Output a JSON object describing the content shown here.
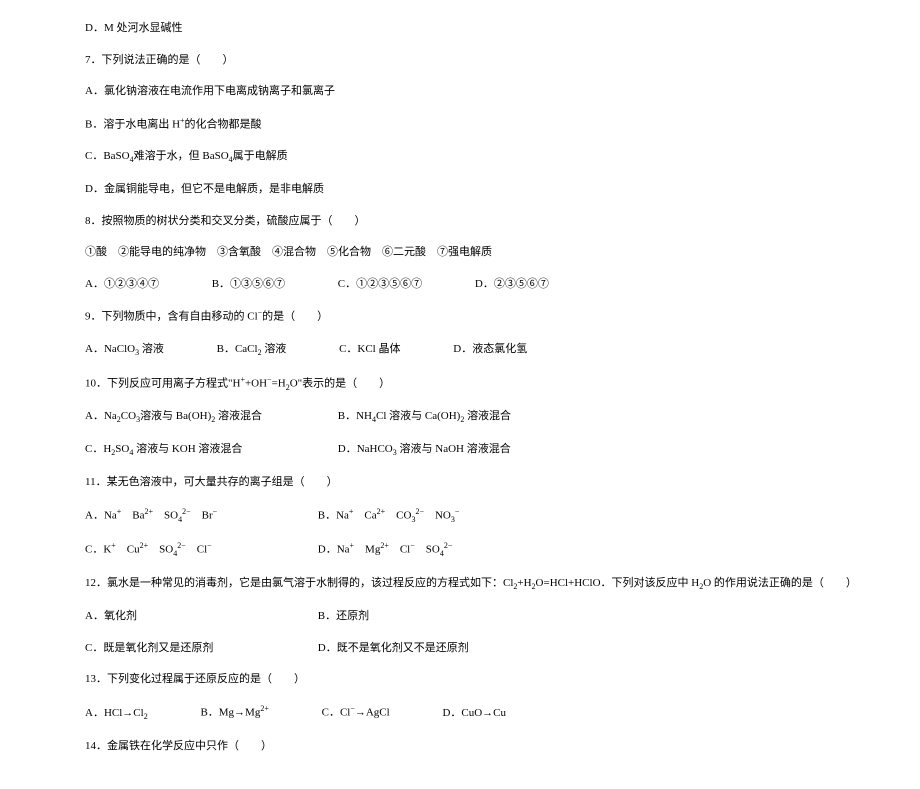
{
  "q6_d": "D．M 处河水显碱性",
  "q7": {
    "stem": "7．下列说法正确的是（　　）",
    "a": "A．氯化钠溶液在电流作用下电离成钠离子和氯离子",
    "b": "B．溶于水电离出 H⁺的化合物都是酸",
    "c": "C．BaSO₄难溶于水，但 BaSO₄属于电解质",
    "d": "D．金属铜能导电，但它不是电解质，是非电解质"
  },
  "q8": {
    "stem": "8．按照物质的树状分类和交叉分类，硫酸应属于（　　）",
    "categories": "①酸　②能导电的纯净物　③含氧酸　④混合物　⑤化合物　⑥二元酸　⑦强电解质",
    "a": "A．①②③④⑦",
    "b": "B．①③⑤⑥⑦",
    "c": "C．①②③⑤⑥⑦",
    "d": "D．②③⑤⑥⑦"
  },
  "q9": {
    "stem": "9．下列物质中，含有自由移动的 Cl⁻的是（　　）",
    "a": "A．NaClO₃ 溶液",
    "b": "B．CaCl₂ 溶液",
    "c": "C．KCl 晶体",
    "d": "D．液态氯化氢"
  },
  "q10": {
    "stem": "10．下列反应可用离子方程式\"H⁺+OH⁻=H₂O\"表示的是（　　）",
    "a": "A．Na₂CO₃溶液与 Ba(OH)₂ 溶液混合",
    "b": "B．NH₄Cl 溶液与 Ca(OH)₂ 溶液混合",
    "c": "C．H₂SO₄ 溶液与 KOH 溶液混合",
    "d": "D．NaHCO₃ 溶液与 NaOH 溶液混合"
  },
  "q11": {
    "stem": "11．某无色溶液中，可大量共存的离子组是（　　）",
    "a_label": "A．",
    "a_ions": "Na⁺　Ba²⁺　SO₄²⁻　Br⁻",
    "b_label": "B．",
    "b_ions": "Na⁺　Ca²⁺　CO₃²⁻　NO₃⁻",
    "c_label": "C．",
    "c_ions": "K⁺　Cu²⁺　SO₄²⁻　Cl⁻",
    "d_label": "D．",
    "d_ions": "Na⁺　Mg²⁺　Cl⁻　SO₄²⁻"
  },
  "q12": {
    "stem": "12．氯水是一种常见的消毒剂，它是由氯气溶于水制得的，该过程反应的方程式如下：Cl₂+H₂O=HCl+HClO．下列对该反应中 H₂O 的作用说法正确的是（　　）",
    "a": "A．氧化剂",
    "b": "B．还原剂",
    "c": "C．既是氧化剂又是还原剂",
    "d": "D．既不是氧化剂又不是还原剂"
  },
  "q13": {
    "stem": "13．下列变化过程属于还原反应的是（　　）",
    "a": "A．HCl→Cl₂",
    "b": "B．Mg→Mg²⁺",
    "c": "C．Cl⁻→AgCl",
    "d": "D．CuO→Cu"
  },
  "q14": {
    "stem": "14．金属铁在化学反应中只作（　　）"
  }
}
